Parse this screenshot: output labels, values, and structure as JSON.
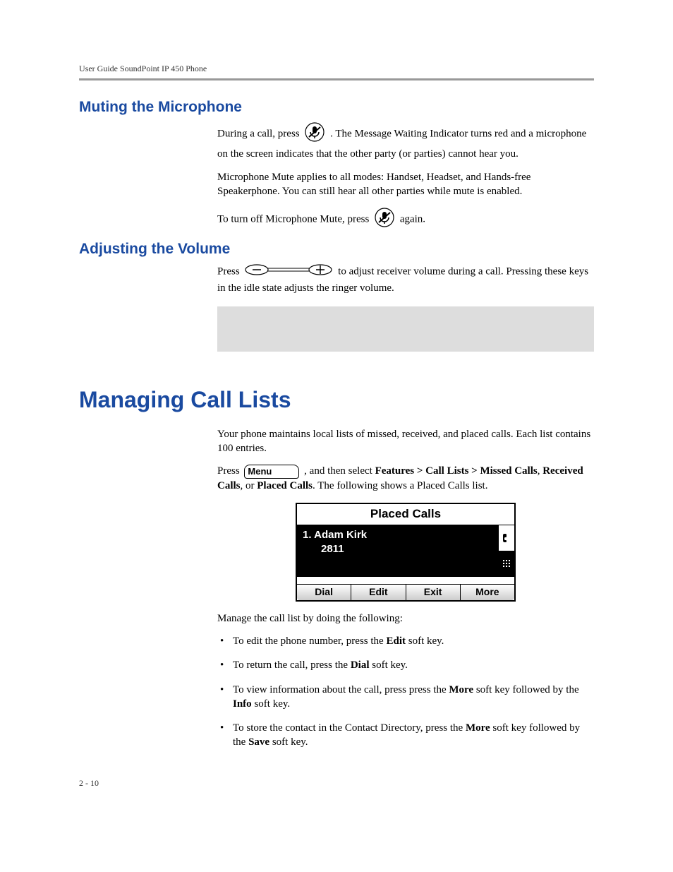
{
  "header": {
    "running_head": "User Guide SoundPoint IP 450 Phone"
  },
  "sections": {
    "mute": {
      "title": "Muting the Microphone",
      "p1a": "During a call, press ",
      "p1b": " . The Message Waiting Indicator turns red and a microphone on the screen indicates that the other party (or parties) cannot hear you.",
      "p2": "Microphone Mute applies to all modes: Handset, Headset, and Hands-free Speakerphone. You can still hear all other parties while mute is enabled.",
      "p3a": "To turn off Microphone Mute, press ",
      "p3b": " again."
    },
    "volume": {
      "title": "Adjusting the Volume",
      "p1a": "Press ",
      "p1b": " to adjust receiver volume during a call. Pressing these keys in the idle state adjusts the ringer volume."
    },
    "calls": {
      "title": "Managing Call Lists",
      "intro": "Your phone maintains local lists of missed, received, and placed calls. Each list contains 100 entries.",
      "nav1a": "Press ",
      "nav1_menu": "Menu",
      "nav1b": " , and then select ",
      "nav1_path": "Features > Call Lists > Missed Calls",
      "nav2a": ", ",
      "nav2_rc": "Received Calls",
      "nav2b": ", or ",
      "nav2_pc": "Placed Calls",
      "nav2c": ". The following shows a Placed Calls list.",
      "manage_intro": "Manage the call list by doing the following:",
      "bullets": {
        "b1a": "To edit the phone number, press the ",
        "b1_key": "Edit",
        "b1b": " soft key.",
        "b2a": "To return the call, press the ",
        "b2_key": "Dial",
        "b2b": " soft key.",
        "b3a": "To view information about the call, press press the ",
        "b3_key1": "More",
        "b3b": " soft key followed by the ",
        "b3_key2": "Info",
        "b3c": " soft key.",
        "b4a": "To store the contact in the Contact Directory, press the ",
        "b4_key1": "More",
        "b4b": " soft key followed by the ",
        "b4_key2": "Save",
        "b4c": " soft key."
      }
    }
  },
  "lcd": {
    "title": "Placed Calls",
    "row_name": "1.  Adam Kirk",
    "row_num": "2811",
    "softkeys": [
      "Dial",
      "Edit",
      "Exit",
      "More"
    ]
  },
  "footer": {
    "page_num": "2 - 10"
  }
}
